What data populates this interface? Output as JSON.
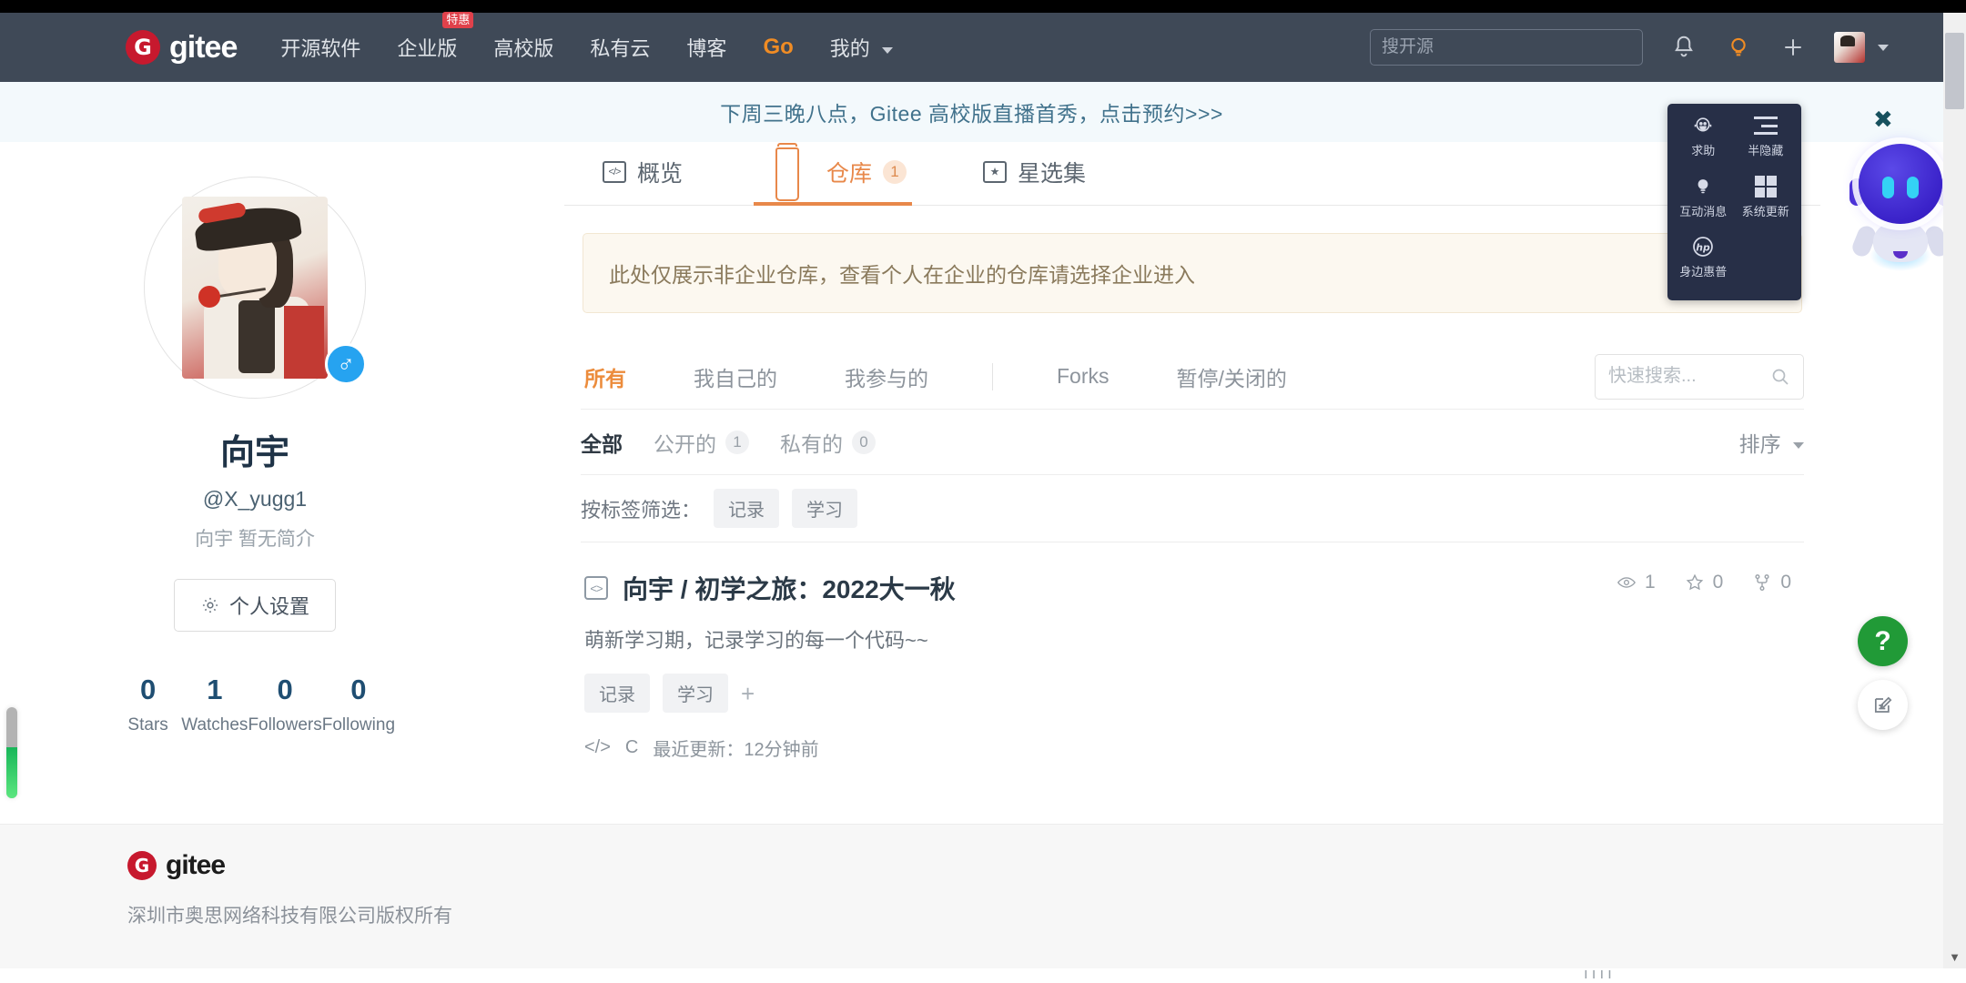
{
  "header": {
    "brand": "gitee",
    "brand_mark": "G",
    "nav": [
      {
        "label": "开源软件",
        "badge": ""
      },
      {
        "label": "企业版",
        "badge": "特惠"
      },
      {
        "label": "高校版",
        "badge": ""
      },
      {
        "label": "私有云",
        "badge": ""
      },
      {
        "label": "博客",
        "badge": ""
      },
      {
        "label": "Go",
        "badge": ""
      },
      {
        "label": "我的",
        "badge": ""
      }
    ],
    "search_placeholder": "搜开源",
    "search_value": "",
    "icons": [
      "bell-icon",
      "lightbulb-icon",
      "plus-icon",
      "avatar-icon"
    ]
  },
  "promo": {
    "text": "下周三晚八点，Gitee 高校版直播首秀，点击预约>>>"
  },
  "profile": {
    "name": "向宇",
    "handle": "@X_yugg1",
    "bio": "向宇 暂无简介",
    "settings_label": "个人设置",
    "gender_symbol": "♂",
    "stats": [
      {
        "value": "0",
        "label": "Stars"
      },
      {
        "value": "1",
        "label": "Watches"
      },
      {
        "value": "0",
        "label": "Followers"
      },
      {
        "value": "0",
        "label": "Following"
      }
    ]
  },
  "tabs": [
    {
      "label": "概览",
      "count": "",
      "icon": "overview-icon",
      "active": false
    },
    {
      "label": "仓库",
      "count": "1",
      "icon": "repo-icon",
      "active": true
    },
    {
      "label": "星选集",
      "count": "",
      "icon": "star-collection-icon",
      "active": false
    }
  ],
  "notice": {
    "text": "此处仅展示非企业仓库，查看个人在企业的仓库请选择企业进入"
  },
  "filters": {
    "primary": [
      "所有",
      "我自己的",
      "我参与的",
      "Forks",
      "暂停/关闭的"
    ],
    "primary_active": "所有",
    "quick_search_placeholder": "快速搜索...",
    "quick_search_value": "",
    "visibility": [
      {
        "label": "全部",
        "count": "",
        "active": true
      },
      {
        "label": "公开的",
        "count": "1",
        "active": false
      },
      {
        "label": "私有的",
        "count": "0",
        "active": false
      }
    ],
    "sort_label": "排序",
    "tag_filter_label": "按标签筛选：",
    "tags": [
      "记录",
      "学习"
    ]
  },
  "repositories": [
    {
      "owner": "向宇",
      "separator": "/",
      "name": "初学之旅：2022大一秋",
      "description": "萌新学习期，记录学习的每一个代码~~",
      "tags": [
        "记录",
        "学习"
      ],
      "language": "C",
      "updated": "最近更新：12分钟前",
      "watches": "1",
      "stars": "0",
      "forks": "0"
    }
  ],
  "footer": {
    "brand": "gitee",
    "brand_mark": "G",
    "copyright": "深圳市奥思网络科技有限公司版权所有"
  },
  "hp_panel": {
    "items": [
      {
        "label": "求助",
        "icon": "headset-smiley-icon"
      },
      {
        "label": "半隐藏",
        "icon": "collapse-panel-icon"
      },
      {
        "label": "互动消息",
        "icon": "lightbulb-icon"
      },
      {
        "label": "系统更新",
        "icon": "windows-icon"
      },
      {
        "label": "身边惠普",
        "icon": "hp-logo-icon"
      }
    ]
  },
  "mascot": {
    "close_label": "✖"
  },
  "fab": {
    "help_label": "?",
    "edit_label": "✎"
  },
  "colors": {
    "header_bg": "#3f4957",
    "accent_orange": "#e8884a",
    "brand_red": "#c7192e",
    "notice_bg": "#fcf8f0",
    "promo_bg": "#f3f9fc",
    "panel_bg": "#272f47",
    "help_green": "#219a37"
  }
}
